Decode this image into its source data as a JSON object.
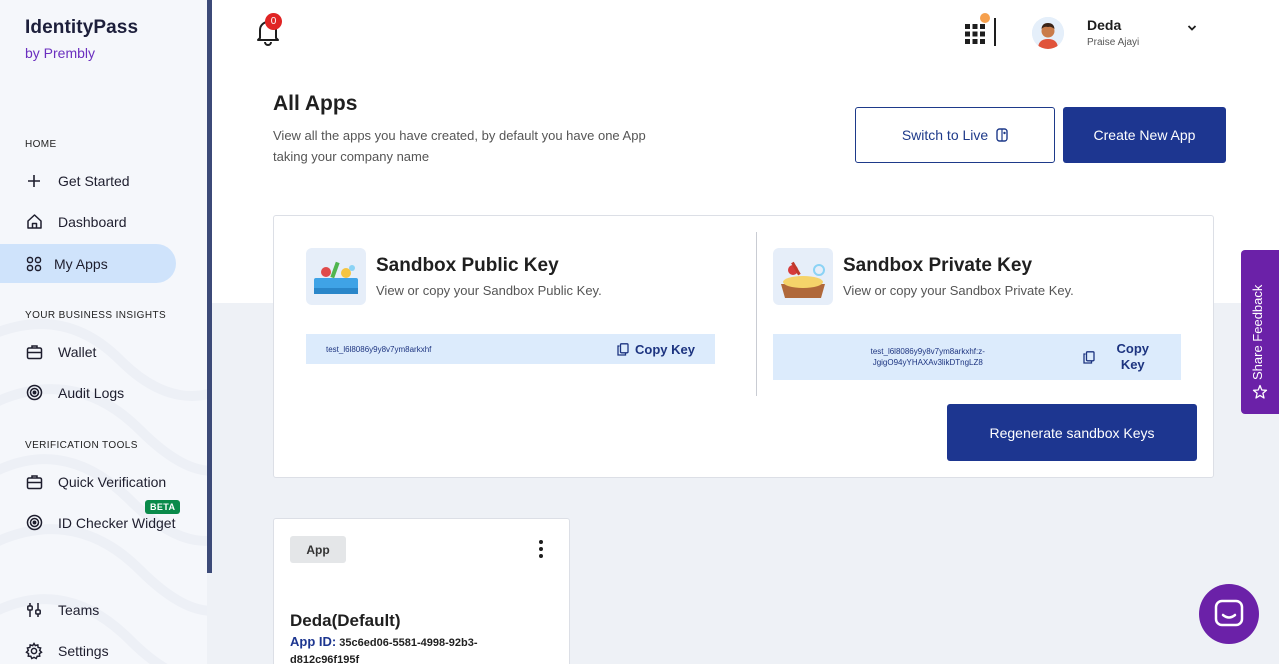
{
  "brand": {
    "name": "IdentityPass",
    "sub": "by Prembly"
  },
  "sidebar": {
    "sections": [
      {
        "label": "HOME"
      },
      {
        "label": "YOUR BUSINESS INSIGHTS"
      },
      {
        "label": "VERIFICATION TOOLS"
      }
    ],
    "items": [
      {
        "label": "Get Started",
        "icon": "plus-icon"
      },
      {
        "label": "Dashboard",
        "icon": "home-icon"
      },
      {
        "label": "My Apps",
        "icon": "apps-icon",
        "active": true
      },
      {
        "label": "Wallet",
        "icon": "briefcase-icon"
      },
      {
        "label": "Audit Logs",
        "icon": "target-icon"
      },
      {
        "label": "Quick Verification",
        "icon": "briefcase-icon"
      },
      {
        "label": "ID Checker Widget",
        "icon": "target-icon",
        "badge": "BETA"
      },
      {
        "label": "Teams",
        "icon": "sliders-icon"
      },
      {
        "label": "Settings",
        "icon": "gear-icon"
      }
    ]
  },
  "header": {
    "notification_count": "0",
    "user_name": "Deda",
    "user_sub": "Praise Ajayi"
  },
  "page": {
    "title": "All Apps",
    "description": "View all the apps you have created, by default you have one App taking your company name",
    "switch_live_label": "Switch to Live",
    "create_app_label": "Create New App"
  },
  "keys": {
    "public": {
      "title": "Sandbox Public Key",
      "desc": "View or copy your Sandbox Public Key.",
      "value": "test_l6l8086y9y8v7ym8arkxhf",
      "copy_label": "Copy Key"
    },
    "private": {
      "title": "Sandbox Private Key",
      "desc": "View or copy your Sandbox Private Key.",
      "value_line1": "test_l6l8086y9y8v7ym8arkxhf:z-",
      "value_line2": "JgigO94yYHAXAv3likDTngLZ8",
      "copy_label_1": "Copy",
      "copy_label_2": "Key"
    },
    "regenerate_label": "Regenerate sandbox Keys"
  },
  "app_card": {
    "tag": "App",
    "name": "Deda(Default)",
    "id_label": "App ID:",
    "id_value": "35c6ed06-5581-4998-92b3-d812c96f195f"
  },
  "feedback": {
    "label": "Share Feedback"
  },
  "colors": {
    "primary": "#1d3690",
    "accent_purple": "#6b21a8",
    "active_nav": "#cfe3fb",
    "key_box": "#dcebfc",
    "beta_badge": "#0a8a4a",
    "notification_badge": "#e02424"
  }
}
